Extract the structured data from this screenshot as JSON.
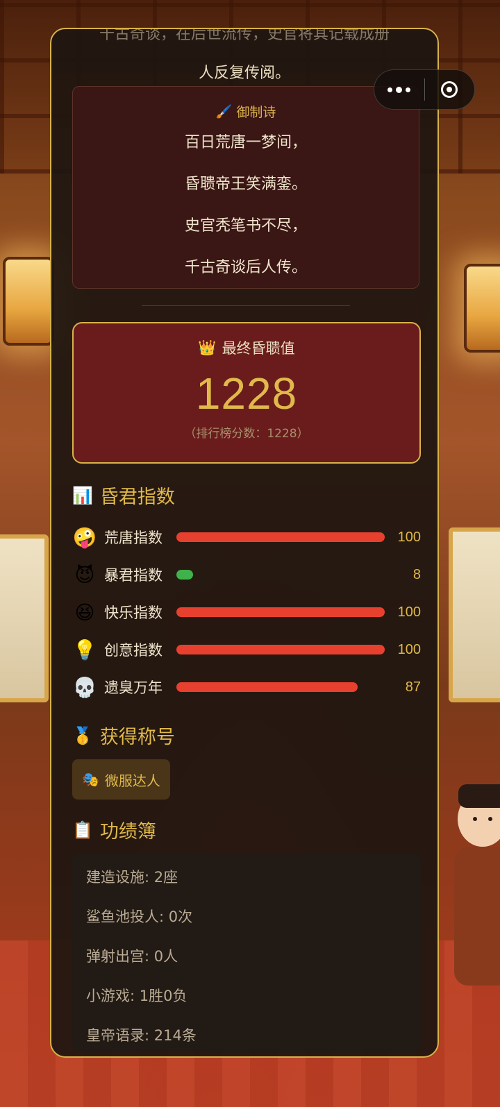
{
  "intro": {
    "line1": "千古奇谈，在后世流传，史官将其记载成册",
    "line2": "人反复传阅。"
  },
  "poem": {
    "title": "御制诗",
    "lines": [
      "百日荒唐一梦间，",
      "昏聩帝王笑满銮。",
      "史官秃笔书不尽，",
      "千古奇谈后人传。"
    ]
  },
  "score": {
    "title": "最终昏聩值",
    "value": "1228",
    "subtitle": "（排行榜分数：1228）"
  },
  "index_section": {
    "title": "昏君指数",
    "stats": [
      {
        "emoji": "🤪",
        "label": "荒唐指数",
        "value": 100
      },
      {
        "emoji": "😈",
        "label": "暴君指数",
        "value": 8
      },
      {
        "emoji": "😆",
        "label": "快乐指数",
        "value": 100
      },
      {
        "emoji": "💡",
        "label": "创意指数",
        "value": 100
      },
      {
        "emoji": "💀",
        "label": "遗臭万年",
        "value": 87
      }
    ],
    "colors": {
      "bar": "#e8402f",
      "low_bar": "#3fb24b",
      "value_text": "#e0b94a"
    }
  },
  "title_section": {
    "title": "获得称号",
    "badge_emoji": "🎭",
    "badge_label": "微服达人"
  },
  "records_section": {
    "title": "功绩簿",
    "items": [
      "建造设施: 2座",
      "鲨鱼池投人: 0次",
      "弹射出宫: 0人",
      "小游戏: 1胜0负",
      "皇帝语录: 214条"
    ]
  },
  "capsule": {
    "more_icon": "more-dots-icon",
    "close_icon": "target-close-icon"
  }
}
